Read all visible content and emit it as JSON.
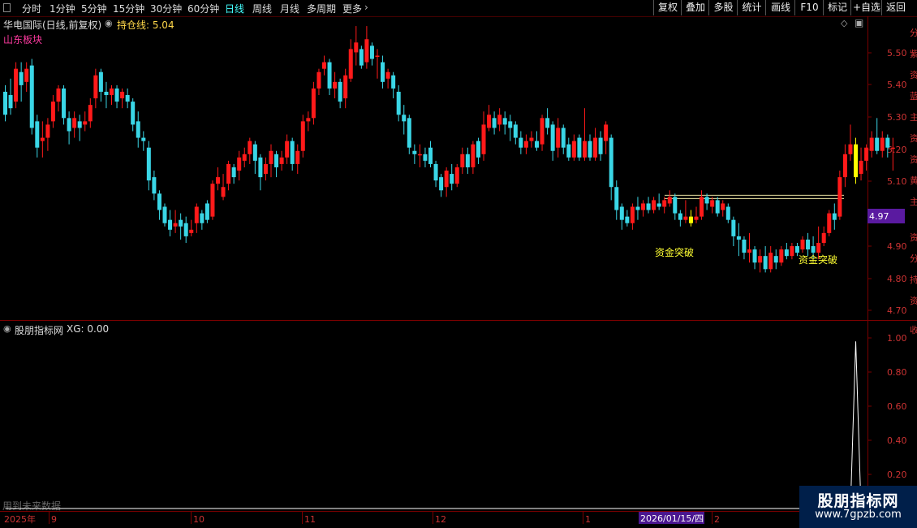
{
  "toolbar": {
    "periods": [
      "分时",
      "1分钟",
      "5分钟",
      "15分钟",
      "30分钟",
      "60分钟",
      "日线",
      "周线",
      "月线",
      "多周期",
      "更多"
    ],
    "active_period": "日线",
    "right_buttons": [
      "复权",
      "叠加",
      "多股",
      "统计",
      "画线",
      "F10",
      "标记",
      "+自选",
      "返回"
    ]
  },
  "header": {
    "stock_title": "华电国际(日线,前复权)",
    "position_line": "持仓线: 5.04",
    "sector": "山东板块"
  },
  "indicator": {
    "title": "股朋指标网",
    "value": "XG: 0.00",
    "future_note": "用到未来数据"
  },
  "price_axis": {
    "ticks": [
      "5.50",
      "5.40",
      "5.30",
      "5.20",
      "5.10",
      "4.90",
      "4.80",
      "4.70"
    ],
    "current": "4.97"
  },
  "indicator_axis": {
    "ticks": [
      "1.00",
      "0.80",
      "0.60",
      "0.40",
      "0.20"
    ]
  },
  "date_axis": {
    "labels": [
      "2025年",
      "9",
      "10",
      "11",
      "12",
      "1",
      "2"
    ],
    "cursor_date": "2026/01/15/四"
  },
  "signals": [
    "资金突破",
    "资金突破"
  ],
  "right_edge_chars": [
    "分",
    "紫",
    "资",
    "蓝",
    "主",
    "资",
    "资",
    "黄",
    "主",
    "资",
    "分",
    "持",
    "资",
    "收"
  ],
  "watermark": {
    "name": "股朋指标网",
    "url": "www.7gpzb.com"
  },
  "colors": {
    "up": "#ff1a1a",
    "down": "#3ad6e6",
    "signal": "#ffff00",
    "active": "#44ffff",
    "grid": "#7a0000",
    "axis_text": "#cc3333",
    "current_price_bg": "#5a1aa0"
  },
  "chart_data": {
    "type": "candlestick",
    "price_range": [
      4.67,
      5.58
    ],
    "position_line": 5.04,
    "candles": [
      [
        5.36,
        5.29,
        5.38,
        5.27
      ],
      [
        5.35,
        5.31,
        5.4,
        5.29
      ],
      [
        5.33,
        5.43,
        5.45,
        5.31
      ],
      [
        5.42,
        5.38,
        5.45,
        5.33
      ],
      [
        5.39,
        5.43,
        5.45,
        5.36
      ],
      [
        5.44,
        5.25,
        5.46,
        5.23
      ],
      [
        5.27,
        5.19,
        5.29,
        5.16
      ],
      [
        5.21,
        5.22,
        5.27,
        5.16
      ],
      [
        5.22,
        5.26,
        5.28,
        5.18
      ],
      [
        5.27,
        5.33,
        5.35,
        5.25
      ],
      [
        5.33,
        5.37,
        5.38,
        5.3
      ],
      [
        5.37,
        5.28,
        5.38,
        5.26
      ],
      [
        5.28,
        5.24,
        5.3,
        5.2
      ],
      [
        5.25,
        5.28,
        5.3,
        5.22
      ],
      [
        5.27,
        5.25,
        5.29,
        5.21
      ],
      [
        5.26,
        5.27,
        5.3,
        5.24
      ],
      [
        5.27,
        5.32,
        5.34,
        5.25
      ],
      [
        5.34,
        5.41,
        5.43,
        5.31
      ],
      [
        5.42,
        5.36,
        5.43,
        5.33
      ],
      [
        5.36,
        5.35,
        5.39,
        5.31
      ],
      [
        5.35,
        5.37,
        5.38,
        5.32
      ],
      [
        5.37,
        5.33,
        5.38,
        5.31
      ],
      [
        5.34,
        5.36,
        5.37,
        5.31
      ],
      [
        5.35,
        5.33,
        5.37,
        5.31
      ],
      [
        5.33,
        5.26,
        5.34,
        5.24
      ],
      [
        5.27,
        5.22,
        5.3,
        5.19
      ],
      [
        5.22,
        5.21,
        5.24,
        5.18
      ],
      [
        5.19,
        5.09,
        5.21,
        5.06
      ],
      [
        5.1,
        5.05,
        5.12,
        5.03
      ],
      [
        5.05,
        5.0,
        5.06,
        4.97
      ],
      [
        5.01,
        4.96,
        5.02,
        4.95
      ],
      [
        4.97,
        4.94,
        5.0,
        4.92
      ],
      [
        4.95,
        4.96,
        5.0,
        4.93
      ],
      [
        4.97,
        4.95,
        4.99,
        4.91
      ],
      [
        4.96,
        4.92,
        4.98,
        4.9
      ],
      [
        4.93,
        4.94,
        4.97,
        4.92
      ],
      [
        4.96,
        5.01,
        5.02,
        4.93
      ],
      [
        4.99,
        4.96,
        5.0,
        4.94
      ],
      [
        5.02,
        4.97,
        5.03,
        4.96
      ],
      [
        4.98,
        5.08,
        5.09,
        4.97
      ],
      [
        5.08,
        5.1,
        5.13,
        5.06
      ],
      [
        5.04,
        5.07,
        5.11,
        5.03
      ],
      [
        5.08,
        5.14,
        5.15,
        5.06
      ],
      [
        5.13,
        5.1,
        5.14,
        5.08
      ],
      [
        5.12,
        5.16,
        5.18,
        5.09
      ],
      [
        5.15,
        5.17,
        5.19,
        5.13
      ],
      [
        5.17,
        5.21,
        5.22,
        5.14
      ],
      [
        5.2,
        5.15,
        5.21,
        5.11
      ],
      [
        5.16,
        5.1,
        5.17,
        5.06
      ],
      [
        5.11,
        5.14,
        5.16,
        5.09
      ],
      [
        5.14,
        5.18,
        5.2,
        5.1
      ],
      [
        5.17,
        5.13,
        5.18,
        5.1
      ],
      [
        5.14,
        5.16,
        5.18,
        5.12
      ],
      [
        5.16,
        5.21,
        5.23,
        5.14
      ],
      [
        5.21,
        5.14,
        5.22,
        5.12
      ],
      [
        5.14,
        5.18,
        5.2,
        5.11
      ],
      [
        5.18,
        5.27,
        5.29,
        5.16
      ],
      [
        5.27,
        5.28,
        5.3,
        5.24
      ],
      [
        5.28,
        5.37,
        5.39,
        5.26
      ],
      [
        5.37,
        5.42,
        5.43,
        5.35
      ],
      [
        5.43,
        5.45,
        5.47,
        5.41
      ],
      [
        5.45,
        5.37,
        5.46,
        5.35
      ],
      [
        5.37,
        5.39,
        5.42,
        5.34
      ],
      [
        5.39,
        5.33,
        5.4,
        5.31
      ],
      [
        5.34,
        5.41,
        5.43,
        5.31
      ],
      [
        5.4,
        5.49,
        5.52,
        5.39
      ],
      [
        5.48,
        5.51,
        5.56,
        5.44
      ],
      [
        5.49,
        5.44,
        5.5,
        5.43
      ],
      [
        5.45,
        5.52,
        5.56,
        5.43
      ],
      [
        5.5,
        5.46,
        5.51,
        5.44
      ],
      [
        5.47,
        5.47,
        5.49,
        5.4
      ],
      [
        5.45,
        5.39,
        5.47,
        5.37
      ],
      [
        5.4,
        5.42,
        5.43,
        5.37
      ],
      [
        5.41,
        5.37,
        5.42,
        5.34
      ],
      [
        5.36,
        5.29,
        5.38,
        5.27
      ],
      [
        5.29,
        5.27,
        5.32,
        5.23
      ],
      [
        5.28,
        5.19,
        5.29,
        5.17
      ],
      [
        5.18,
        5.17,
        5.2,
        5.14
      ],
      [
        5.17,
        5.17,
        5.2,
        5.13
      ],
      [
        5.17,
        5.15,
        5.19,
        5.13
      ],
      [
        5.19,
        5.14,
        5.21,
        5.13
      ],
      [
        5.14,
        5.09,
        5.15,
        5.07
      ],
      [
        5.1,
        5.06,
        5.11,
        5.04
      ],
      [
        5.07,
        5.12,
        5.13,
        5.04
      ],
      [
        5.11,
        5.08,
        5.14,
        5.06
      ],
      [
        5.08,
        5.13,
        5.14,
        5.07
      ],
      [
        5.13,
        5.17,
        5.19,
        5.11
      ],
      [
        5.17,
        5.13,
        5.19,
        5.11
      ],
      [
        5.13,
        5.2,
        5.21,
        5.11
      ],
      [
        5.21,
        5.16,
        5.22,
        5.14
      ],
      [
        5.17,
        5.26,
        5.3,
        5.15
      ],
      [
        5.25,
        5.29,
        5.32,
        5.24
      ],
      [
        5.28,
        5.25,
        5.3,
        5.23
      ],
      [
        5.26,
        5.29,
        5.31,
        5.24
      ],
      [
        5.28,
        5.26,
        5.3,
        5.23
      ],
      [
        5.27,
        5.25,
        5.29,
        5.21
      ],
      [
        5.26,
        5.22,
        5.27,
        5.2
      ],
      [
        5.22,
        5.19,
        5.24,
        5.17
      ],
      [
        5.19,
        5.21,
        5.23,
        5.17
      ],
      [
        5.21,
        5.22,
        5.24,
        5.19
      ],
      [
        5.21,
        5.19,
        5.24,
        5.18
      ],
      [
        5.2,
        5.28,
        5.29,
        5.18
      ],
      [
        5.28,
        5.25,
        5.31,
        5.23
      ],
      [
        5.26,
        5.18,
        5.27,
        5.15
      ],
      [
        5.19,
        5.25,
        5.28,
        5.16
      ],
      [
        5.25,
        5.19,
        5.26,
        5.17
      ],
      [
        5.2,
        5.16,
        5.22,
        5.15
      ],
      [
        5.16,
        5.21,
        5.23,
        5.15
      ],
      [
        5.22,
        5.16,
        5.23,
        5.15
      ],
      [
        5.16,
        5.21,
        5.31,
        5.15
      ],
      [
        5.21,
        5.16,
        5.23,
        5.15
      ],
      [
        5.16,
        5.22,
        5.25,
        5.15
      ],
      [
        5.22,
        5.17,
        5.24,
        5.15
      ],
      [
        5.21,
        5.26,
        5.27,
        5.17
      ],
      [
        5.22,
        5.07,
        5.23,
        5.03
      ],
      [
        5.07,
        5.0,
        5.09,
        4.97
      ],
      [
        5.01,
        4.97,
        5.02,
        4.94
      ],
      [
        4.98,
        4.96,
        5.0,
        4.95
      ],
      [
        4.96,
        5.01,
        5.02,
        4.94
      ],
      [
        5.01,
        5.0,
        5.04,
        4.97
      ],
      [
        5.0,
        5.02,
        5.03,
        4.98
      ],
      [
        5.02,
        5.0,
        5.04,
        4.99
      ],
      [
        5.0,
        5.03,
        5.04,
        4.99
      ],
      [
        5.02,
        5.01,
        5.05,
        5.0
      ],
      [
        5.01,
        5.03,
        5.04,
        4.99
      ],
      [
        5.02,
        5.04,
        5.06,
        5.01
      ],
      [
        5.04,
        4.99,
        5.05,
        4.97
      ],
      [
        4.99,
        4.97,
        5.0,
        4.95
      ],
      [
        4.97,
        4.98,
        5.03,
        4.96
      ],
      [
        4.98,
        4.96,
        5.0,
        4.95
      ],
      [
        4.97,
        4.98,
        5.01,
        4.96
      ],
      [
        4.98,
        5.04,
        5.06,
        4.97
      ],
      [
        5.04,
        5.02,
        5.05,
        5.0
      ],
      [
        5.01,
        5.03,
        5.04,
        4.99
      ],
      [
        5.03,
        4.99,
        5.04,
        4.98
      ],
      [
        5.0,
        5.02,
        5.03,
        4.98
      ],
      [
        5.01,
        4.97,
        5.02,
        4.96
      ],
      [
        4.97,
        4.92,
        4.98,
        4.89
      ],
      [
        4.92,
        4.91,
        4.96,
        4.86
      ],
      [
        4.91,
        4.87,
        4.92,
        4.85
      ],
      [
        4.87,
        4.88,
        4.93,
        4.84
      ],
      [
        4.88,
        4.84,
        4.89,
        4.82
      ],
      [
        4.84,
        4.86,
        4.88,
        4.81
      ],
      [
        4.86,
        4.82,
        4.89,
        4.81
      ],
      [
        4.82,
        4.87,
        4.89,
        4.81
      ],
      [
        4.86,
        4.84,
        4.88,
        4.82
      ],
      [
        4.84,
        4.88,
        4.89,
        4.83
      ],
      [
        4.88,
        4.86,
        4.9,
        4.85
      ],
      [
        4.86,
        4.89,
        4.9,
        4.85
      ],
      [
        4.89,
        4.87,
        4.9,
        4.86
      ],
      [
        4.88,
        4.91,
        4.92,
        4.87
      ],
      [
        4.91,
        4.88,
        4.93,
        4.86
      ],
      [
        4.89,
        4.87,
        4.92,
        4.85
      ],
      [
        4.87,
        4.9,
        4.95,
        4.85
      ],
      [
        4.9,
        4.93,
        4.95,
        4.89
      ],
      [
        4.93,
        4.99,
        5.0,
        4.92
      ],
      [
        4.99,
        4.97,
        5.02,
        4.94
      ],
      [
        4.98,
        5.1,
        5.12,
        4.97
      ],
      [
        5.1,
        5.17,
        5.2,
        5.07
      ],
      [
        5.17,
        5.2,
        5.26,
        5.15
      ],
      [
        5.2,
        5.1,
        5.22,
        5.08
      ],
      [
        5.11,
        5.15,
        5.19,
        5.09
      ],
      [
        5.15,
        5.19,
        5.2,
        5.12
      ],
      [
        5.18,
        5.22,
        5.24,
        5.16
      ],
      [
        5.22,
        5.18,
        5.28,
        5.17
      ],
      [
        5.18,
        5.22,
        5.24,
        5.16
      ],
      [
        5.22,
        5.19,
        5.23,
        5.16
      ],
      [
        5.19,
        5.19,
        5.22,
        5.12
      ]
    ],
    "signal_indices": [
      129,
      160
    ],
    "indicator": {
      "name": "XG",
      "range": [
        0,
        1.05
      ],
      "spike_index": 160,
      "spike_value": 1.0
    }
  }
}
